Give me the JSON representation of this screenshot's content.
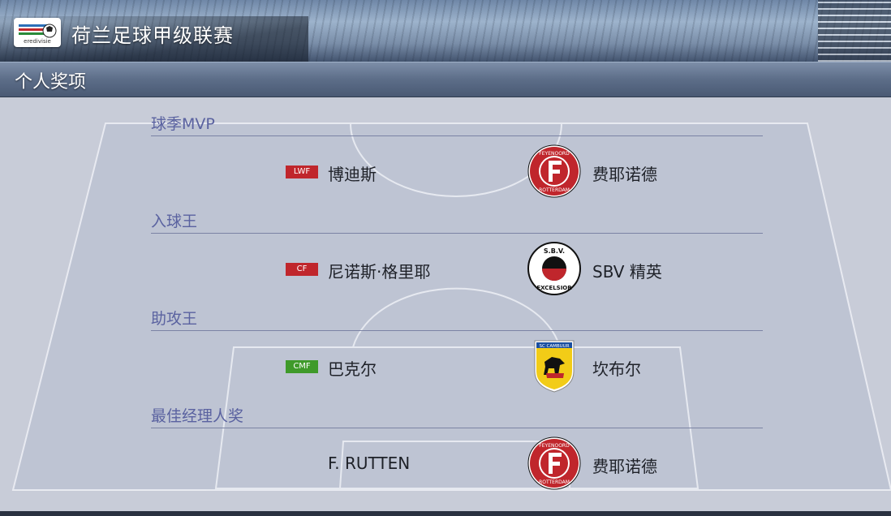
{
  "header": {
    "league_title": "荷兰足球甲级联赛",
    "league_logo_text": "eredivisie"
  },
  "section": {
    "title": "个人奖项"
  },
  "awards": [
    {
      "heading": "球季MVP",
      "position": "LWF",
      "position_color": "#c0262c",
      "player": "博迪斯",
      "club_crest": "feyenoord-crest",
      "club": "费耶诺德"
    },
    {
      "heading": "入球王",
      "position": "CF",
      "position_color": "#c0262c",
      "player": "尼诺斯·格里耶",
      "club_crest": "excelsior-crest",
      "club": "SBV  精英"
    },
    {
      "heading": "助攻王",
      "position": "CMF",
      "position_color": "#3f9a2a",
      "player": "巴克尔",
      "club_crest": "cambuur-crest",
      "club": "坎布尔"
    },
    {
      "heading": "最佳经理人奖",
      "position": "",
      "player": "F.  RUTTEN",
      "club_crest": "feyenoord-crest",
      "club": "费耶诺德"
    }
  ],
  "crest_text": {
    "feyenoord_top": "FEYENOORD",
    "feyenoord_bottom": "ROTTERDAM",
    "excelsior_top": "S.B.V.",
    "excelsior_bottom": "EXCELSIOR",
    "cambuur_top": "SC CAMBUUR"
  },
  "colors": {
    "accent_heading": "#5a62a0",
    "badge_red": "#c0262c",
    "badge_green": "#3f9a2a",
    "panel_bg": "#c8ccd8"
  }
}
